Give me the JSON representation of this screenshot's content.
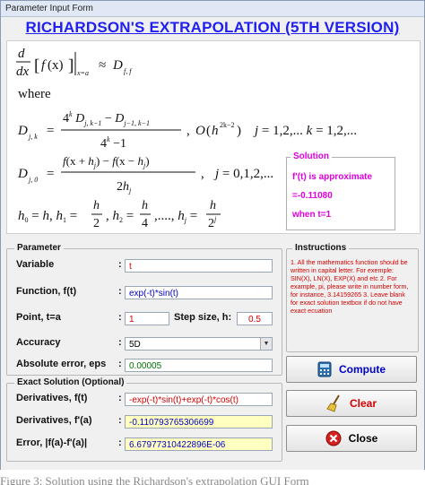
{
  "window": {
    "title": "Parameter Input Form"
  },
  "heading": "RICHARDSON'S EXTRAPOLATION (5TH VERSION)",
  "formula": {
    "where": "where"
  },
  "solution": {
    "legend": "Solution",
    "line1": "f'(t) is approximate",
    "line2": "=-0.11080",
    "line3": "when t=1"
  },
  "parameter": {
    "legend": "Parameter",
    "variable_label": "Variable",
    "variable_value": "t",
    "function_label": "Function, f(t)",
    "function_value": "exp(-t)*sin(t)",
    "point_label": "Point,  t=a",
    "point_value": "1",
    "step_label": "Step size, h:",
    "step_value": "0.5",
    "accuracy_label": "Accuracy",
    "accuracy_value": "5D",
    "abserr_label": "Absolute error, eps",
    "abserr_value": "0.00005"
  },
  "exact": {
    "legend": "Exact Solution (Optional)",
    "deriv_label": "Derivatives, f(t)",
    "deriv_value": "-exp(-t)*sin(t)+exp(-t)*cos(t)",
    "derivat_label": "Derivatives, f'(a)",
    "derivat_value": "-0.110793765306699",
    "error_label": "Error, |f(a)-f'(a)|",
    "error_value": "6.67977310422896E-06"
  },
  "instructions": {
    "legend": "Instructions",
    "text": "1. All the mathematics function should be written in capital letter. For exemple: SIN(X), LN(X), EXP(X) and etc 2. For example, pi, please write in number form, for instance, 3.14159265 3. Leave blank for exact solution textbox if do not have exact ecuation"
  },
  "buttons": {
    "compute": "Compute",
    "clear": "Clear",
    "close": "Close"
  },
  "caption": "Figure 3: Solution using the Richardson's extrapolation GUI Form",
  "colors": {
    "accent": "#1f1ff0",
    "magenta": "#e000e0",
    "red": "#d40000",
    "blue": "#0000c8",
    "green": "#007000"
  },
  "icons": [
    "calculator-icon",
    "broom-icon",
    "close-icon"
  ]
}
